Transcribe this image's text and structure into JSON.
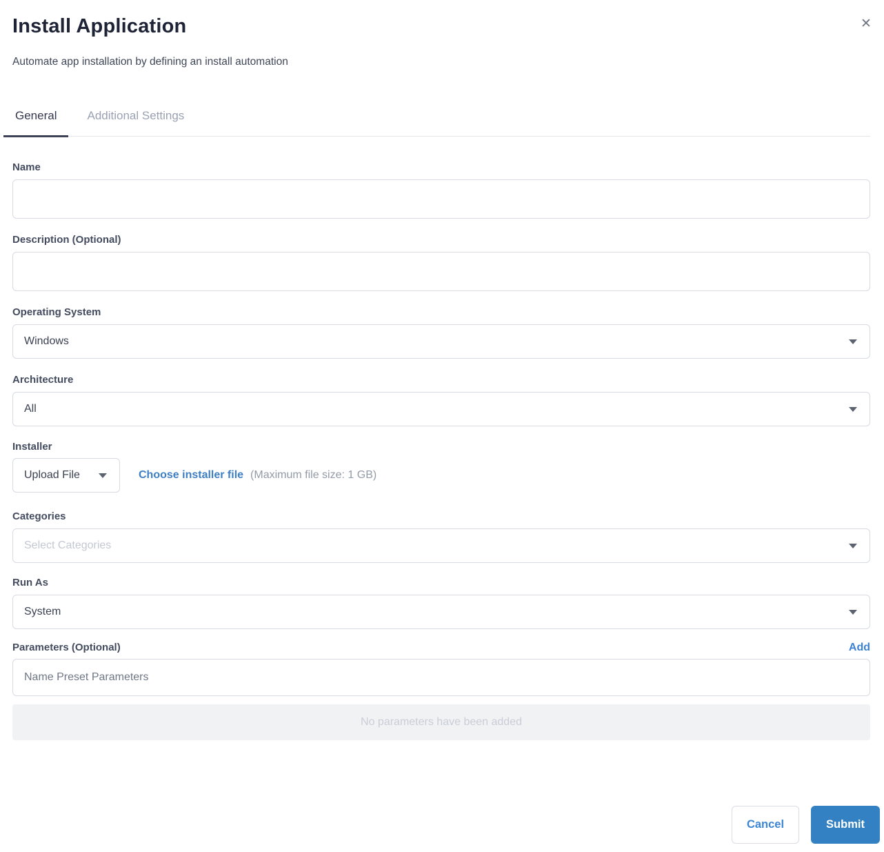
{
  "dialog": {
    "title": "Install Application",
    "subtitle": "Automate app installation by defining an install automation"
  },
  "icons": {
    "close": "✕"
  },
  "tabs": [
    {
      "label": "General",
      "active": true
    },
    {
      "label": "Additional Settings",
      "active": false
    }
  ],
  "fields": {
    "name": {
      "label": "Name",
      "value": ""
    },
    "description": {
      "label": "Description (Optional)",
      "value": ""
    },
    "operating_system": {
      "label": "Operating System",
      "value": "Windows"
    },
    "architecture": {
      "label": "Architecture",
      "value": "All"
    },
    "installer": {
      "label": "Installer",
      "value": "Upload File",
      "link_label": "Choose installer file",
      "note": "(Maximum file size: 1 GB)"
    },
    "categories": {
      "label": "Categories",
      "placeholder": "Select Categories"
    },
    "run_as": {
      "label": "Run As",
      "value": "System"
    },
    "parameters": {
      "label": "Parameters (Optional)",
      "add_label": "Add",
      "placeholder": "Name Preset Parameters",
      "empty_message": "No parameters have been added"
    }
  },
  "footer": {
    "cancel_label": "Cancel",
    "submit_label": "Submit"
  },
  "colors": {
    "accent_blue": "#3381c3",
    "link_blue": "#3e7fc4",
    "active_tab_underline": "#3e4258",
    "empty_box_bg": "#f1f2f4"
  }
}
